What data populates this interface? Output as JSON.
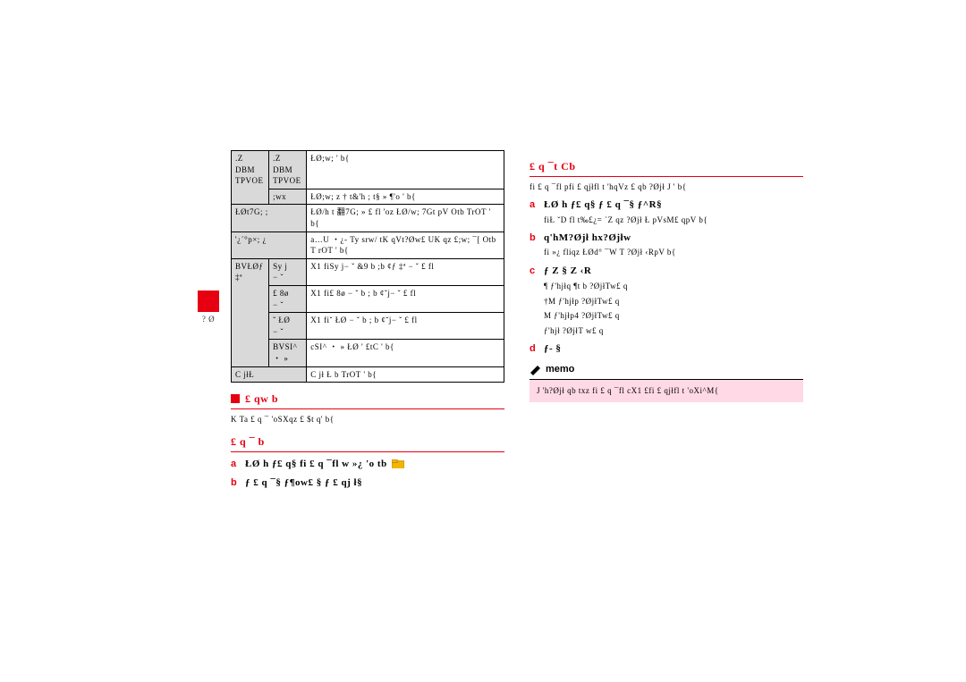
{
  "sidebar": {
    "label": "?\nØ"
  },
  "table": {
    "rows": [
      {
        "c0": ".Z DBM\nTPVOE",
        "c1": ".Z DBM\nTPVOE",
        "c2": "ŁØ;w; ' b{",
        "span01": false,
        "shade01": true
      },
      {
        "c0": "",
        "c1": ";wx",
        "c2": "ŁØ;w; z † t&'h ; t§ » ¶'o ' b{",
        "shade01": true
      },
      {
        "c0": "ŁØt7G; ;",
        "c1": "",
        "c2": "ŁØ/h t 翻7G; » £ fl 'oz ŁØ/w; 7Gt pV Otb TrOT ' b{",
        "span01": true,
        "shade01": true
      },
      {
        "c0": "'¿´°p×; ¿",
        "c1": "",
        "c2": "a…U ・¿- Ty srw/ tK qVt?Øw£ UK qz £;w; ¯[ Otb T rOT ' b{",
        "span01": true,
        "shade01": true
      },
      {
        "c0": "BVŁØƒ\n‡ª",
        "c1": "Sy j\n− ˇ",
        "c2": "X1 fiSy j− ˇ &9 b ;b ¢ƒ ‡ª − ˇ £ fl",
        "shade01": true
      },
      {
        "c0": "",
        "c1": "£ 8ø\n− ˇ",
        "c2": "X1 fi£ 8ø − ˇ b ; b ¢ˇj− ˇ £ fl",
        "shade01": true
      },
      {
        "c0": "",
        "c1": "ˇ ŁØ\n− ˇ",
        "c2": "X1 fiˇ ŁØ − ˇ b ; b ¢ˇj− ˇ £ fl",
        "shade01": true
      },
      {
        "c0": "",
        "c1": "BVSI^\n・ »",
        "c2": "cSI^ ・ » ŁØ ' £tC ' b{",
        "shade01": true
      },
      {
        "c0": "C jłŁ",
        "c1": "",
        "c2": "C jł Ł b TrOT ' b{",
        "span01": true,
        "shade01": true
      }
    ]
  },
  "left": {
    "h1": "£ qw b",
    "p1": "K Ta £ q ¯ 'oSXqz £ $t q' b{",
    "h2": "£ q ¯ b",
    "step_a": {
      "l": "a",
      "t": "ŁØ h ƒ£ q§ fi £ q ¯fl w »¿ 'o tb"
    },
    "step_b": {
      "l": "b",
      "t": "ƒ £ q ¯§ ƒ¶ow£ § ƒ £ qj ł§"
    }
  },
  "right": {
    "h1": "£ q ¯t Cb",
    "p1": "fi £ q ¯fl pfi £ qjłfl t 'hqVz £ qb ?Øjł J ' b{",
    "step_a": {
      "l": "a",
      "t": "ŁØ h ƒ£ q§ ƒ £ q ¯§ ƒ^R§",
      "note": "fiŁ ˇD fl t‰£¿= `Z qz ?Øjł Ł pVsM£ qpV b{"
    },
    "step_b": {
      "l": "b",
      "t": "q'hM?Øjł hx?Øjłw",
      "note": "fi »¿ fliqz ŁØd° ¯W T ?Øjł ‹RpV b{"
    },
    "step_c": {
      "l": "c",
      "t": "ƒ Z § Z ‹R",
      "subs": [
        "¶ ƒ'hjłq ¶t b ?ØjłTw£ q",
        "†M ƒ'hjłp ?ØjłTw£ q",
        "M ƒ'hjłp4 ?ØjłTw£ q",
        "ƒ'hjł ?ØjłT w£ q"
      ]
    },
    "step_d": {
      "l": "d",
      "t": "ƒ- §"
    }
  },
  "memo": {
    "label": "memo",
    "body": "J 'h?Øjł qb txz fi £ q ¯fl cX1 £fi £ qjłfl t 'oXi^M{"
  }
}
